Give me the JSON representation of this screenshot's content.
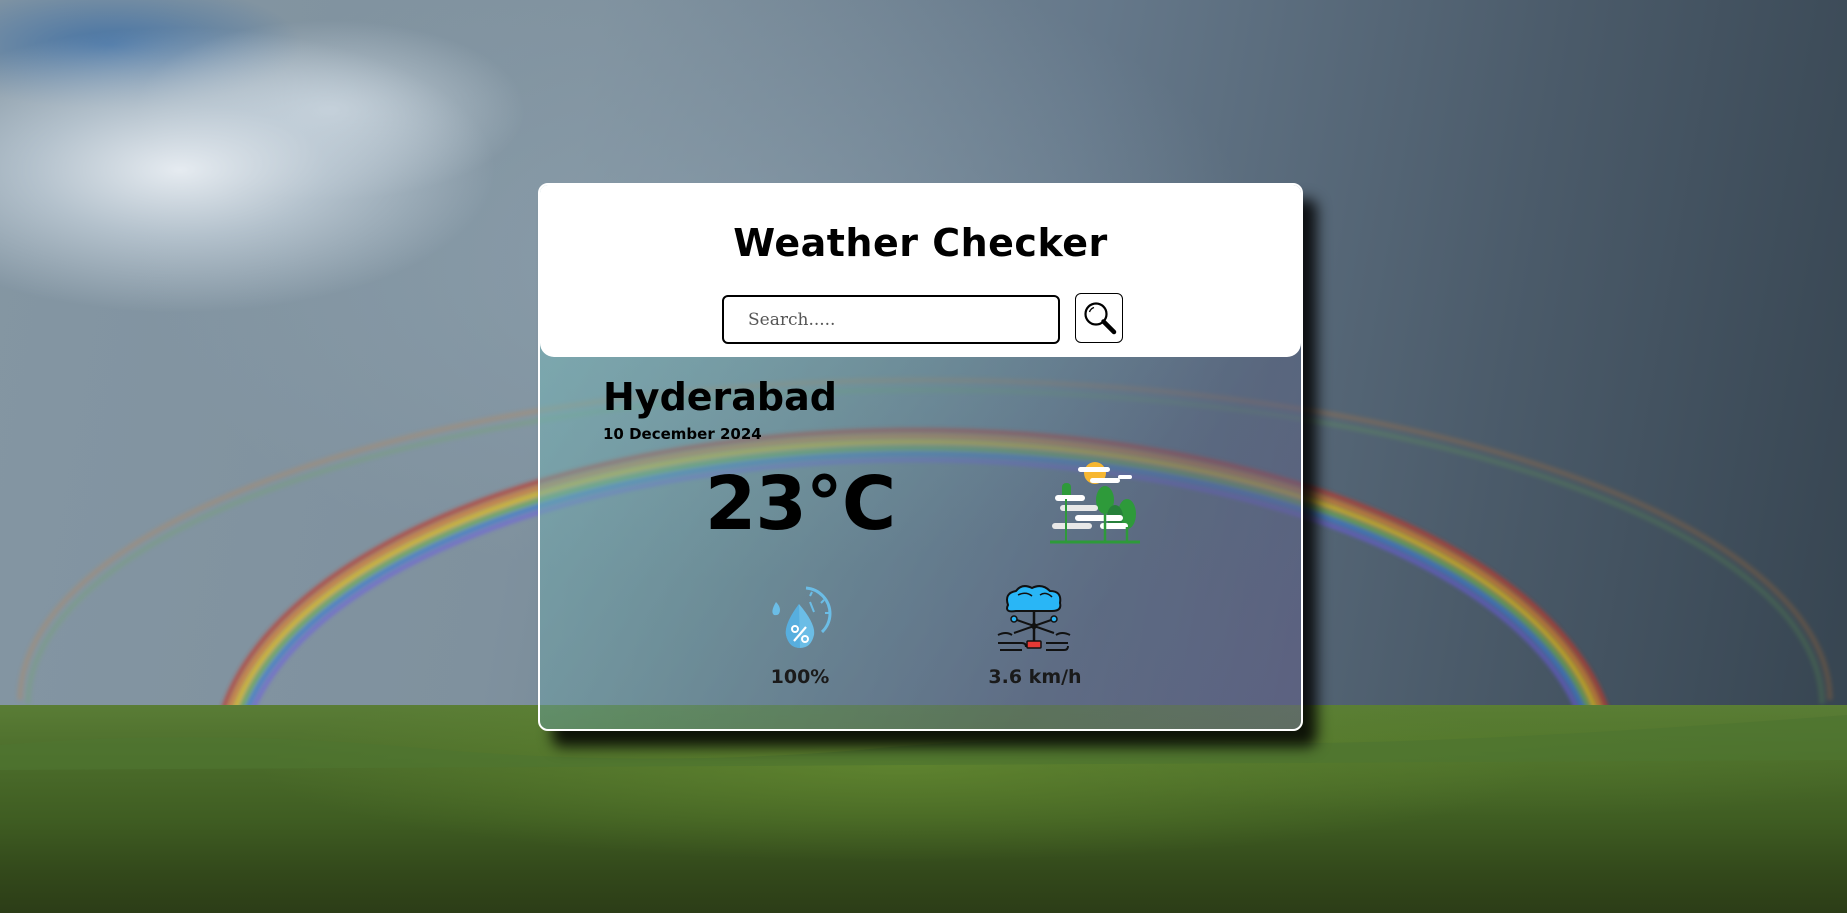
{
  "app": {
    "title": "Weather Checker"
  },
  "search": {
    "placeholder": "Search.....",
    "value": "",
    "button_icon": "search-icon"
  },
  "weather": {
    "city": "Hyderabad",
    "date": "10 December 2024",
    "temperature": "23°C",
    "condition_icon": "sun-cloud-trees-icon",
    "humidity": {
      "icon": "humidity-icon",
      "value": "100%"
    },
    "wind": {
      "icon": "wind-speed-icon",
      "value": "3.6 km/h"
    }
  },
  "colors": {
    "card_border": "#ffffff",
    "text": "#000000",
    "accent_blue": "#29b6f6",
    "tree_green": "#2e9a3a",
    "sun_yellow": "#f7b731"
  }
}
